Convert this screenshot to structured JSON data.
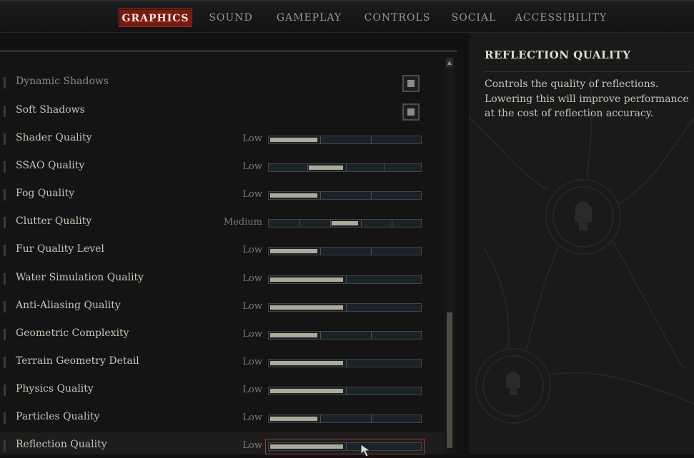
{
  "nav": {
    "tabs": [
      {
        "label": "GRAPHICS",
        "active": true
      },
      {
        "label": "SOUND",
        "active": false
      },
      {
        "label": "GAMEPLAY",
        "active": false
      },
      {
        "label": "CONTROLS",
        "active": false
      },
      {
        "label": "SOCIAL",
        "active": false
      },
      {
        "label": "ACCESSIBILITY",
        "active": false
      }
    ]
  },
  "settings": {
    "dynamic_shadows": {
      "label": "Dynamic Shadows",
      "checked": true
    },
    "soft_shadows": {
      "label": "Soft Shadows",
      "checked": true
    },
    "sliders": [
      {
        "label": "Shader Quality",
        "value": "Low",
        "segments": 3,
        "level": 1
      },
      {
        "label": "SSAO Quality",
        "value": "Low",
        "segments": 4,
        "level": 2
      },
      {
        "label": "Fog Quality",
        "value": "Low",
        "segments": 3,
        "level": 1
      },
      {
        "label": "Clutter Quality",
        "value": "Medium",
        "segments": 5,
        "level": 3
      },
      {
        "label": "Fur Quality Level",
        "value": "Low",
        "segments": 3,
        "level": 1
      },
      {
        "label": "Water Simulation Quality",
        "value": "Low",
        "segments": 2,
        "level": 1
      },
      {
        "label": "Anti-Aliasing Quality",
        "value": "Low",
        "segments": 2,
        "level": 1
      },
      {
        "label": "Geometric Complexity",
        "value": "Low",
        "segments": 3,
        "level": 1
      },
      {
        "label": "Terrain Geometry Detail",
        "value": "Low",
        "segments": 2,
        "level": 1
      },
      {
        "label": "Physics Quality",
        "value": "Low",
        "segments": 2,
        "level": 1
      },
      {
        "label": "Particles Quality",
        "value": "Low",
        "segments": 3,
        "level": 1
      },
      {
        "label": "Reflection Quality",
        "value": "Low",
        "segments": 2,
        "level": 1
      }
    ]
  },
  "info": {
    "title": "REFLECTION QUALITY",
    "description": "Controls the quality of reflections. Lowering this will improve performance at the cost of reflection accuracy."
  },
  "colors": {
    "active_tab": "#7a1a12",
    "slider_fill": "#b0a898",
    "selection_border": "#9c3a2a"
  }
}
